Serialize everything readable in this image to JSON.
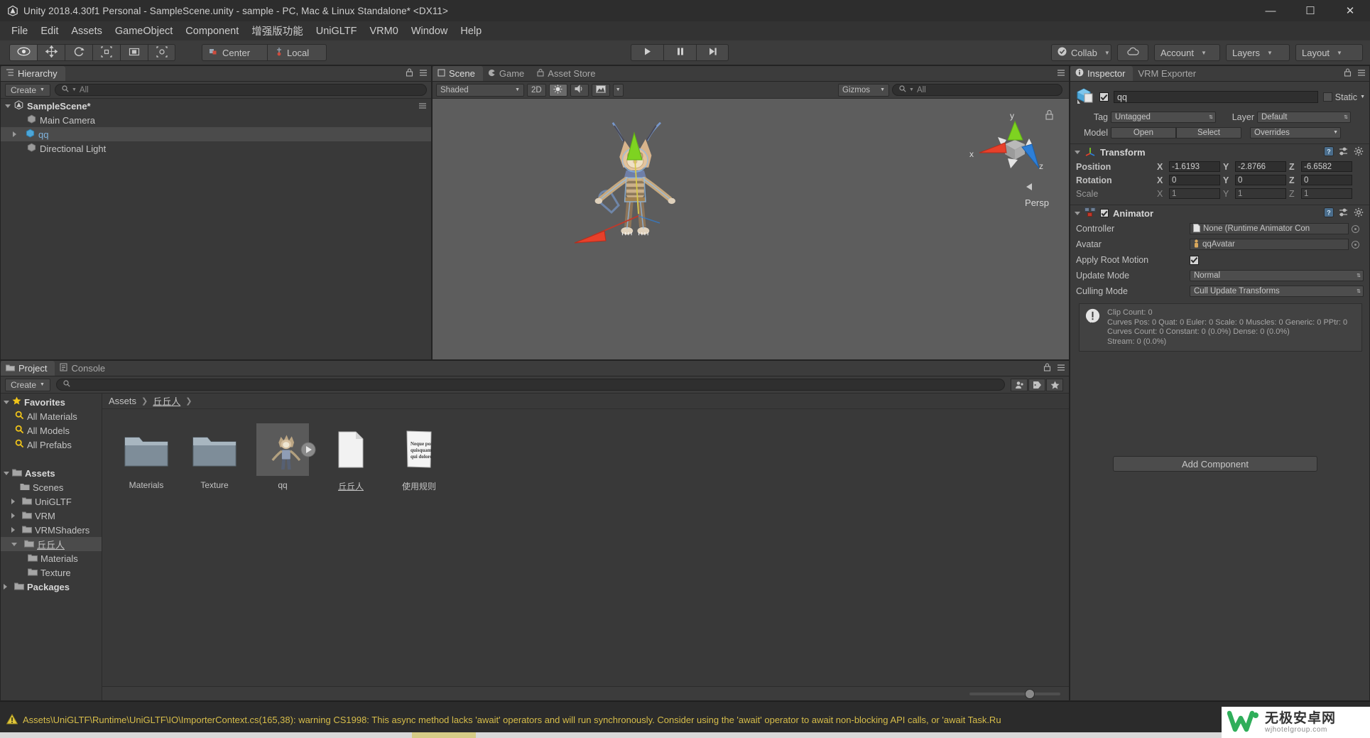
{
  "window": {
    "title": "Unity 2018.4.30f1 Personal - SampleScene.unity - sample - PC, Mac & Linux Standalone* <DX11>",
    "logo_icon": "unity-logo-icon",
    "minimize": "—",
    "maximize": "☐",
    "close": "✕"
  },
  "menubar": {
    "items": [
      {
        "label": "File"
      },
      {
        "label": "Edit"
      },
      {
        "label": "Assets"
      },
      {
        "label": "GameObject"
      },
      {
        "label": "Component"
      },
      {
        "label": "增强版功能"
      },
      {
        "label": "UniGLTF"
      },
      {
        "label": "VRM0"
      },
      {
        "label": "Window"
      },
      {
        "label": "Help"
      }
    ]
  },
  "toolbar": {
    "transform_tools": [
      {
        "name": "hand-tool",
        "icon": "eye-icon",
        "active": true
      },
      {
        "name": "move-tool",
        "icon": "move-arrows-icon",
        "active": false
      },
      {
        "name": "rotate-tool",
        "icon": "rotate-icon",
        "active": false
      },
      {
        "name": "scale-tool",
        "icon": "scale-icon",
        "active": false
      },
      {
        "name": "rect-tool",
        "icon": "rect-transform-icon",
        "active": false
      },
      {
        "name": "transform-tool",
        "icon": "combined-transform-icon",
        "active": false
      }
    ],
    "pivot_label": "Center",
    "handle_label": "Local",
    "play_controls": [
      {
        "name": "play-button",
        "icon": "play-icon"
      },
      {
        "name": "pause-button",
        "icon": "pause-icon"
      },
      {
        "name": "step-button",
        "icon": "step-icon"
      }
    ],
    "collab_label": "Collab",
    "cloud_icon": "cloud-icon",
    "account_label": "Account",
    "layers_label": "Layers",
    "layout_label": "Layout"
  },
  "hierarchy": {
    "tab_label": "Hierarchy",
    "create_label": "Create",
    "search_placeholder": "All",
    "scene_name": "SampleScene*",
    "items": [
      {
        "label": "Main Camera",
        "selected": false,
        "expandable": false
      },
      {
        "label": "qq",
        "selected": true,
        "expandable": true
      },
      {
        "label": "Directional Light",
        "selected": false,
        "expandable": false
      }
    ]
  },
  "scene_view": {
    "tabs": [
      {
        "label": "Scene",
        "active": true,
        "icon": "scene-icon"
      },
      {
        "label": "Game",
        "active": false,
        "icon": "game-icon"
      },
      {
        "label": "Asset Store",
        "active": false,
        "icon": "store-icon"
      }
    ],
    "draw_mode": "Shaded",
    "mode_2d": "2D",
    "lighting_icon": "sun-icon",
    "audio_icon": "audio-icon",
    "effects_icon": "effects-icon",
    "gizmos_label": "Gizmos",
    "search_placeholder": "All",
    "projection_label": "Persp",
    "axis_x": "x",
    "axis_y": "y",
    "axis_z": "z",
    "lock_icon": "lock-icon"
  },
  "project": {
    "tabs": [
      {
        "label": "Project",
        "active": true,
        "icon": "folder-icon"
      },
      {
        "label": "Console",
        "active": false,
        "icon": "console-icon"
      }
    ],
    "create_label": "Create",
    "search_placeholder": "",
    "filter_icons": [
      "person-filter-icon",
      "label-filter-icon",
      "favorite-filter-icon"
    ],
    "breadcrumb": [
      "Assets",
      "丘丘人"
    ],
    "tree": [
      {
        "label": "Favorites",
        "depth": 0,
        "arrow": "down",
        "icon": "star-icon",
        "bold": true,
        "selected": false
      },
      {
        "label": "All Materials",
        "depth": 1,
        "arrow": "none",
        "icon": "search-icon",
        "bold": false,
        "selected": false
      },
      {
        "label": "All Models",
        "depth": 1,
        "arrow": "none",
        "icon": "search-icon",
        "bold": false,
        "selected": false
      },
      {
        "label": "All Prefabs",
        "depth": 1,
        "arrow": "none",
        "icon": "search-icon",
        "bold": false,
        "selected": false
      },
      {
        "label": "",
        "depth": 0,
        "arrow": "none",
        "icon": "spacer",
        "bold": false,
        "selected": false
      },
      {
        "label": "Assets",
        "depth": 0,
        "arrow": "down",
        "icon": "folder-icon",
        "bold": true,
        "selected": false
      },
      {
        "label": "Scenes",
        "depth": 1,
        "arrow": "none",
        "icon": "folder-icon",
        "bold": false,
        "selected": false
      },
      {
        "label": "UniGLTF",
        "depth": 1,
        "arrow": "right",
        "icon": "folder-icon",
        "bold": false,
        "selected": false
      },
      {
        "label": "VRM",
        "depth": 1,
        "arrow": "right",
        "icon": "folder-icon",
        "bold": false,
        "selected": false
      },
      {
        "label": "VRMShaders",
        "depth": 1,
        "arrow": "right",
        "icon": "folder-icon",
        "bold": false,
        "selected": false
      },
      {
        "label": "丘丘人",
        "depth": 1,
        "arrow": "down",
        "icon": "folder-icon",
        "bold": false,
        "selected": true
      },
      {
        "label": "Materials",
        "depth": 2,
        "arrow": "none",
        "icon": "folder-icon",
        "bold": false,
        "selected": false
      },
      {
        "label": "Texture",
        "depth": 2,
        "arrow": "none",
        "icon": "folder-icon",
        "bold": false,
        "selected": false
      },
      {
        "label": "Packages",
        "depth": 0,
        "arrow": "right",
        "icon": "folder-icon",
        "bold": true,
        "selected": false
      }
    ],
    "grid_items": [
      {
        "label": "Materials",
        "kind": "folder",
        "selected": false,
        "underline": false
      },
      {
        "label": "Texture",
        "kind": "folder",
        "selected": false,
        "underline": false
      },
      {
        "label": "qq",
        "kind": "model",
        "selected": true,
        "underline": false
      },
      {
        "label": "丘丘人",
        "kind": "file",
        "selected": false,
        "underline": true
      },
      {
        "label": "使用规则",
        "kind": "textfile",
        "selected": false,
        "underline": false,
        "preview": "Neque porro quisquam est qui dolorem."
      }
    ]
  },
  "inspector": {
    "tabs": [
      {
        "label": "Inspector",
        "active": true,
        "icon": "info-icon"
      },
      {
        "label": "VRM Exporter",
        "active": false,
        "icon": "none"
      }
    ],
    "object_name": "qq",
    "object_enabled": true,
    "static_label": "Static",
    "tag_label": "Tag",
    "tag_value": "Untagged",
    "layer_label": "Layer",
    "layer_value": "Default",
    "model_label": "Model",
    "open_label": "Open",
    "select_label": "Select",
    "overrides_label": "Overrides",
    "transform": {
      "title": "Transform",
      "rows": [
        {
          "label": "Position",
          "x": "-1.6193",
          "y": "-2.8766",
          "z": "-6.6582",
          "dim": false
        },
        {
          "label": "Rotation",
          "x": "0",
          "y": "0",
          "z": "0",
          "dim": false
        },
        {
          "label": "Scale",
          "x": "1",
          "y": "1",
          "z": "1",
          "dim": true
        }
      ]
    },
    "animator": {
      "title": "Animator",
      "enabled": true,
      "controller_label": "Controller",
      "controller_value": "None (Runtime Animator Con",
      "avatar_label": "Avatar",
      "avatar_value": "qqAvatar",
      "root_motion_label": "Apply Root Motion",
      "root_motion_checked": true,
      "update_mode_label": "Update Mode",
      "update_mode_value": "Normal",
      "culling_mode_label": "Culling Mode",
      "culling_mode_value": "Cull Update Transforms",
      "info_lines": [
        "Clip Count: 0",
        "Curves Pos: 0 Quat: 0 Euler: 0 Scale: 0 Muscles: 0 Generic: 0 PPtr: 0",
        "Curves Count: 0 Constant: 0 (0.0%) Dense: 0 (0.0%)",
        "Stream: 0 (0.0%)"
      ]
    },
    "add_component_label": "Add Component"
  },
  "statusbar": {
    "icon": "warning-icon",
    "message": "Assets\\UniGLTF\\Runtime\\UniGLTF\\IO\\ImporterContext.cs(165,38): warning CS1998: This async method lacks 'await' operators and will run synchronously. Consider using the 'await' operator to await non-blocking API calls, or 'await Task.Ru"
  },
  "watermark": {
    "cn": "无极安卓网",
    "en": "wjhotelgroup.com"
  },
  "colors": {
    "accent_blue": "#4b6eaf",
    "axis_x": "#e74c3c",
    "axis_y": "#7ed321",
    "axis_z": "#2d7fd8",
    "warning": "#d7bd4a",
    "panel_bg": "#3c3c3c",
    "scene_bg": "#5d5d5d"
  }
}
